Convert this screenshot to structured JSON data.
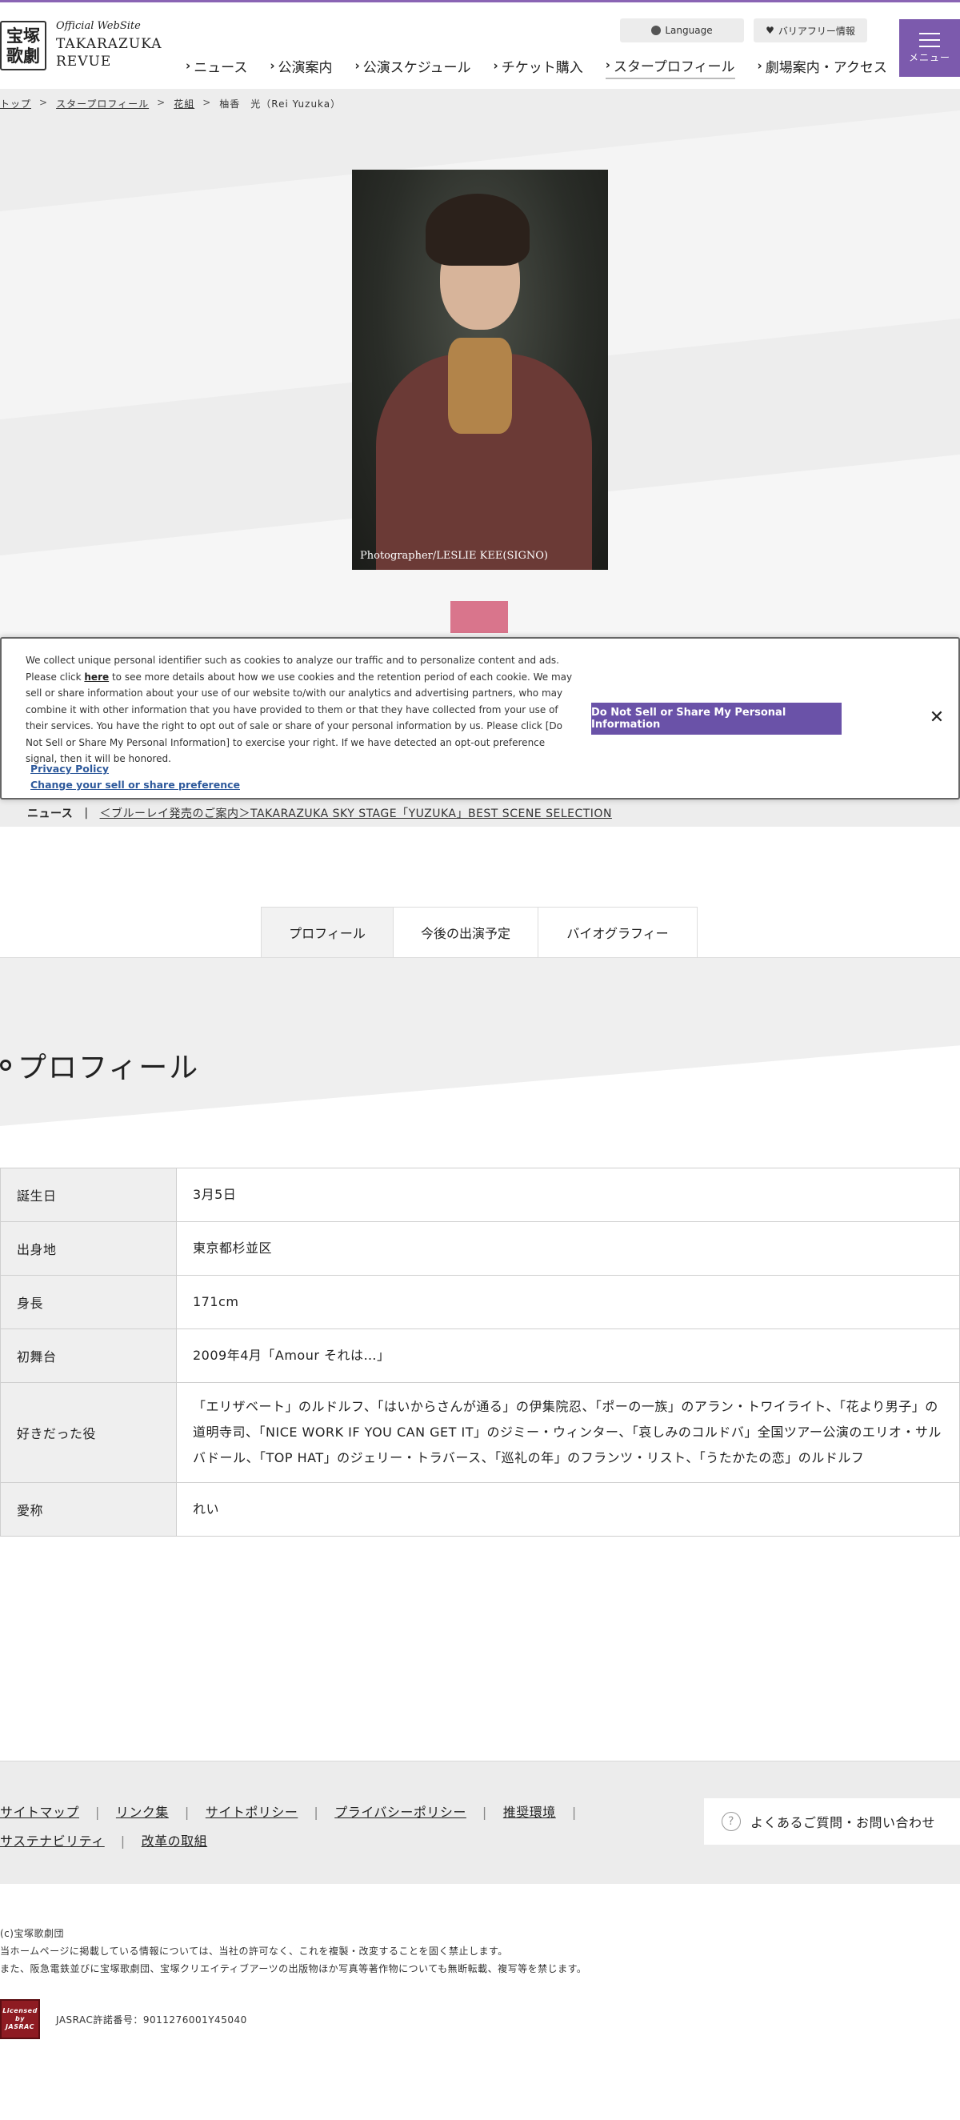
{
  "header": {
    "logo_kanji": "宝塚\n歌劇",
    "logo_line1": "Official WebSite",
    "logo_line2": "TAKARAZUKA",
    "logo_line3": "REVUE",
    "language_label": "Language",
    "barrier_free_label": "バリアフリー情報",
    "menu_label": "メニュー",
    "nav": [
      "ニュース",
      "公演案内",
      "公演スケジュール",
      "チケット購入",
      "スタープロフィール",
      "劇場案内・アクセス"
    ],
    "accent_color": "#7c5aad"
  },
  "breadcrumb": [
    "トップ",
    "スタープロフィール",
    "花組",
    "柚香　光（Rei Yuzuka）"
  ],
  "portrait": {
    "credit": "Photographer/LESLIE KEE(SIGNO)"
  },
  "cookie": {
    "text_before": "We collect unique personal identifier such as cookies to analyze our traffic and to personalize content and ads. Please click ",
    "link_here": "here",
    "text_after": " to see more details about how we use cookies and the retention period of each cookie. We may sell or share information about your use of our website to/with our analytics and advertising partners, who may combine it with other information that you have provided to them or that they have collected from your use of their services. You have the right to opt out of sale or share of your personal information by us. Please click [Do Not Sell or Share My Personal Information] to exercise your right. If we have detected an opt-out preference signal, then it will be honored.",
    "privacy_policy": "Privacy Policy",
    "change_preference": "Change your sell or share preference",
    "cta": "Do Not Sell or Share My Personal Information",
    "close": "✕"
  },
  "news": {
    "label": "ニュース",
    "separator": "|",
    "link": "＜ブルーレイ発売のご案内＞TAKARAZUKA SKY STAGE「YUZUKA」BEST SCENE SELECTION"
  },
  "tabs": [
    "プロフィール",
    "今後の出演予定",
    "バイオグラフィー"
  ],
  "section_title": "プロフィール",
  "profile": [
    {
      "key": "誕生日",
      "value": "3月5日"
    },
    {
      "key": "出身地",
      "value": "東京都杉並区"
    },
    {
      "key": "身長",
      "value": "171cm"
    },
    {
      "key": "初舞台",
      "value": "2009年4月「Amour それは…」"
    },
    {
      "key": "好きだった役",
      "value": "「エリザベート」のルドルフ、「はいからさんが通る」の伊集院忍、「ポーの一族」のアラン・トワイライト、「花より男子」の道明寺司、「NICE WORK IF YOU CAN GET IT」のジミー・ウィンター、「哀しみのコルドバ」全国ツアー公演のエリオ・サルバドール、「TOP HAT」のジェリー・トラバース、「巡礼の年」のフランツ・リスト、「うたかたの恋」のルドルフ"
    },
    {
      "key": "愛称",
      "value": "れい"
    }
  ],
  "footer": {
    "links": [
      "サイトマップ",
      "リンク集",
      "サイトポリシー",
      "プライバシーポリシー",
      "推奨環境",
      "サステナビリティ",
      "改革の取組"
    ],
    "faq": "よくあるご質問・お問い合わせ",
    "copy1": "(c)宝塚歌劇団",
    "copy2": "当ホームページに掲載している情報については、当社の許可なく、これを複製・改変することを固く禁止します。",
    "copy3": "また、阪急電鉄並びに宝塚歌劇団、宝塚クリエイティブアーツの出版物ほか写真等著作物についても無断転載、複写等を禁じます。",
    "jasrac_logo": "Licensed by JASRAC",
    "jasrac": "JASRAC許諾番号：9011276001Y45040"
  }
}
